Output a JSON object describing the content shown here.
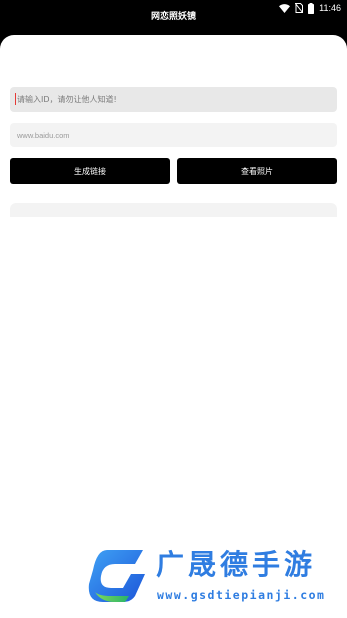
{
  "status_bar": {
    "time": "11:46",
    "icons": [
      "wifi-icon",
      "no-sim-icon",
      "battery-icon"
    ]
  },
  "header": {
    "title": "网恋照妖镜"
  },
  "form": {
    "id_input": {
      "placeholder": "请输入ID，请勿让他人知道!",
      "value": ""
    },
    "url_input": {
      "placeholder": "www.baidu.com",
      "value": ""
    },
    "generate_button": "生成链接",
    "view_button": "查看照片"
  },
  "watermark": {
    "brand": "广晟德手游",
    "url": "www.gsdtiepianji.com"
  },
  "colors": {
    "background": "#ffffff",
    "button": "#000000",
    "input_bg": "#e8e8e8",
    "watermark_blue": "#2f7de1"
  }
}
